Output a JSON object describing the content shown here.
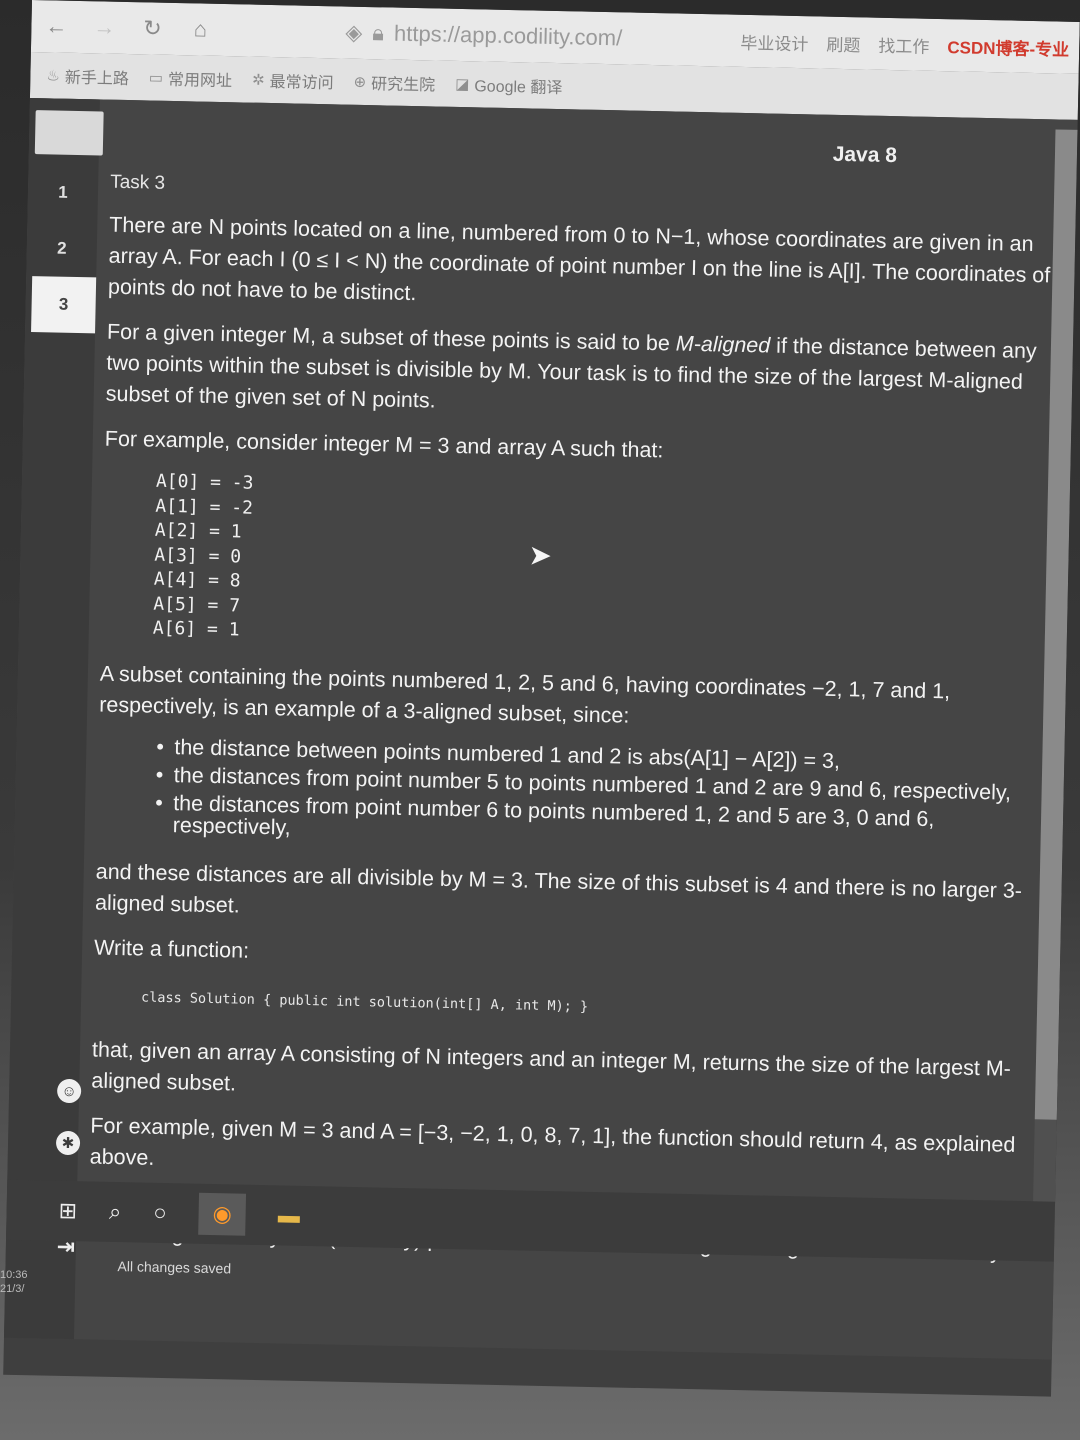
{
  "browser": {
    "url": "https://app.codility.com/",
    "nav": {
      "back": "←",
      "forward": "→",
      "reload": "↻",
      "home": "⌂"
    },
    "tab_links": [
      "毕业设计",
      "刷题",
      "找工作",
      "CSDN博客-专业"
    ],
    "bookmarks": [
      {
        "icon": "fire-icon",
        "glyph": "♨",
        "label": "新手上路"
      },
      {
        "icon": "folder-icon",
        "glyph": "▭",
        "label": "常用网址"
      },
      {
        "icon": "gear-icon",
        "glyph": "✲",
        "label": "最常访问"
      },
      {
        "icon": "globe-icon",
        "glyph": "⊕",
        "label": "研究生院"
      },
      {
        "icon": "translate-icon",
        "glyph": "◪",
        "label": "Google 翻译"
      }
    ]
  },
  "sidebar": {
    "tasks": [
      {
        "label": "1",
        "active": false
      },
      {
        "label": "2",
        "active": false
      },
      {
        "label": "3",
        "active": true
      }
    ]
  },
  "header": {
    "language": "Java 8",
    "task_title": "Task 3"
  },
  "problem": {
    "p1": "There are N points located on a line, numbered from 0 to N−1, whose coordinates are given in an array A. For each I (0 ≤ I < N) the coordinate of point number I on the line is A[I]. The coordinates of points do not have to be distinct.",
    "p2a": "For a given integer M, a subset of these points is said to be ",
    "p2em": "M-aligned",
    "p2b": " if the distance between any two points within the subset is divisible by M. Your task is to find the size of the largest M-aligned subset of the given set of N points.",
    "p3": "For example, consider integer M = 3 and array A such that:",
    "array": [
      "A[0] = -3",
      "A[1] = -2",
      "A[2] = 1",
      "A[3] = 0",
      "A[4] = 8",
      "A[5] = 7",
      "A[6] = 1"
    ],
    "p4": "A subset containing the points numbered 1, 2, 5 and 6, having coordinates −2, 1, 7 and 1, respectively, is an example of a 3-aligned subset, since:",
    "bullets": [
      "the distance between points numbered 1 and 2 is abs(A[1] − A[2]) = 3,",
      "the distances from point number 5 to points numbered 1 and 2 are 9 and 6, respectively,",
      "the distances from point number 6 to points numbered 1, 2 and 5 are 3, 0 and 6, respectively,"
    ],
    "p5": "and these distances are all divisible by M = 3. The size of this subset is 4 and there is no larger 3-aligned subset.",
    "p6": "Write a function:",
    "signature": "class Solution { public int solution(int[] A, int M); }",
    "p7": "that, given an array A consisting of N integers and an integer M, returns the size of the largest M-aligned subset.",
    "p8": "For example, given M = 3 and A = [−3, −2, 1, 0, 8, 7, 1], the function should return 4, as explained above.",
    "p9": "Given M = 8 and A = [7, 1, 11, 8, 4, 10], the function should return 1, since one can create a subset consisting of exactly one (arbitrary) point. Note that this is the largest 8-aligned subset since any"
  },
  "status": {
    "saved": "All changes saved"
  },
  "side_icons": [
    {
      "icon": "accessibility-icon",
      "glyph": "☺"
    },
    {
      "icon": "settings-icon",
      "glyph": "✱"
    },
    {
      "icon": "help-icon",
      "glyph": "?"
    },
    {
      "icon": "logout-icon",
      "glyph": "⇥"
    }
  ],
  "taskbar": {
    "start": "⊞",
    "search": "⌕",
    "cortana": "○",
    "firefox": "◉",
    "explorer": "▬"
  },
  "clock": {
    "time": "10:36",
    "date": "21/3/"
  }
}
